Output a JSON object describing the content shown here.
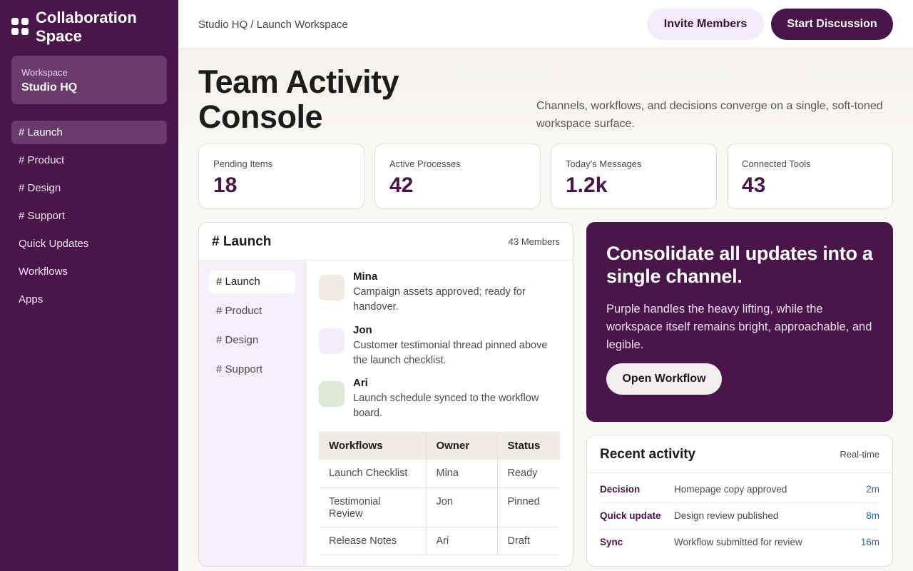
{
  "sidebar": {
    "brand": "Collaboration Space",
    "workspace_label": "Workspace",
    "workspace_name": "Studio HQ",
    "items": [
      {
        "label": "# Launch"
      },
      {
        "label": "# Product"
      },
      {
        "label": "# Design"
      },
      {
        "label": "# Support"
      },
      {
        "label": "Quick Updates"
      },
      {
        "label": "Workflows"
      },
      {
        "label": "Apps"
      }
    ]
  },
  "topbar": {
    "breadcrumb": "Studio HQ / Launch Workspace",
    "invite_label": "Invite Members",
    "start_label": "Start Discussion"
  },
  "hero": {
    "title": "Team Activity Console",
    "subtitle": "Channels, workflows, and decisions converge on a single, soft-toned workspace surface."
  },
  "stats": [
    {
      "label": "Pending Items",
      "value": "18"
    },
    {
      "label": "Active Processes",
      "value": "42"
    },
    {
      "label": "Today's Messages",
      "value": "1.2k"
    },
    {
      "label": "Connected Tools",
      "value": "43"
    }
  ],
  "channel": {
    "title": "# Launch",
    "members": "43 Members",
    "nav": [
      "# Launch",
      "# Product",
      "# Design",
      "# Support"
    ],
    "messages": [
      {
        "name": "Mina",
        "text": "Campaign assets approved; ready for handover.",
        "avatar_color": "#f2ebe2"
      },
      {
        "name": "Jon",
        "text": "Customer testimonial thread pinned above the launch checklist.",
        "avatar_color": "#f4ecfb"
      },
      {
        "name": "Ari",
        "text": "Launch schedule synced to the workflow board.",
        "avatar_color": "#dfe8d6"
      }
    ],
    "table": {
      "headers": [
        "Workflows",
        "Owner",
        "Status"
      ],
      "rows": [
        [
          "Launch Checklist",
          "Mina",
          "Ready"
        ],
        [
          "Testimonial Review",
          "Jon",
          "Pinned"
        ],
        [
          "Release Notes",
          "Ari",
          "Draft"
        ]
      ]
    }
  },
  "promo": {
    "title": "Consolidate all updates into a single channel.",
    "text": "Purple handles the heavy lifting, while the workspace itself remains bright, approachable, and legible.",
    "button": "Open Workflow"
  },
  "recent": {
    "title": "Recent activity",
    "tag": "Real-time",
    "rows": [
      {
        "kind": "Decision",
        "desc": "Homepage copy approved",
        "time": "2m"
      },
      {
        "kind": "Quick update",
        "desc": "Design review published",
        "time": "8m"
      },
      {
        "kind": "Sync",
        "desc": "Workflow submitted for review",
        "time": "16m"
      }
    ]
  },
  "colors": {
    "accent": "#4a154b",
    "link": "#1d6aa0"
  }
}
